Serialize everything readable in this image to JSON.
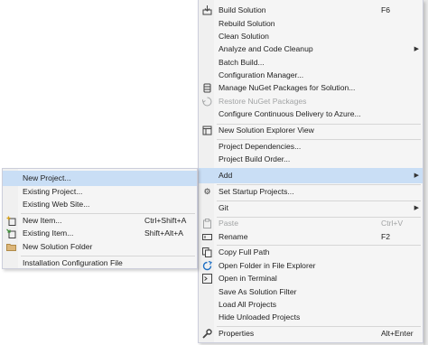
{
  "main_menu": {
    "items": [
      {
        "label": "Build Solution",
        "shortcut": "F6",
        "icon": "build-icon"
      },
      {
        "label": "Rebuild Solution"
      },
      {
        "label": "Clean Solution"
      },
      {
        "label": "Analyze and Code Cleanup",
        "submenu": true
      },
      {
        "label": "Batch Build..."
      },
      {
        "label": "Configuration Manager..."
      },
      {
        "label": "Manage NuGet Packages for Solution...",
        "icon": "nuget-icon"
      },
      {
        "label": "Restore NuGet Packages",
        "icon": "restore-icon",
        "disabled": true
      },
      {
        "label": "Configure Continuous Delivery to Azure..."
      },
      {
        "label": "New Solution Explorer View",
        "icon": "new-view-icon"
      },
      {
        "label": "Project Dependencies..."
      },
      {
        "label": "Project Build Order..."
      },
      {
        "label": "Add",
        "submenu": true,
        "highlighted": true
      },
      {
        "label": "Set Startup Projects...",
        "icon": "gear-icon"
      },
      {
        "label": "Git",
        "submenu": true
      },
      {
        "label": "Paste",
        "shortcut": "Ctrl+V",
        "icon": "paste-icon",
        "disabled": true
      },
      {
        "label": "Rename",
        "shortcut": "F2",
        "icon": "rename-icon"
      },
      {
        "label": "Copy Full Path",
        "icon": "copy-icon"
      },
      {
        "label": "Open Folder in File Explorer",
        "icon": "open-folder-icon"
      },
      {
        "label": "Open in Terminal",
        "icon": "terminal-icon"
      },
      {
        "label": "Save As Solution Filter"
      },
      {
        "label": "Load All Projects"
      },
      {
        "label": "Hide Unloaded Projects"
      },
      {
        "label": "Properties",
        "shortcut": "Alt+Enter",
        "icon": "wrench-icon"
      }
    ]
  },
  "add_submenu": {
    "items": [
      {
        "label": "New Project...",
        "highlighted": true
      },
      {
        "label": "Existing Project..."
      },
      {
        "label": "Existing Web Site..."
      },
      {
        "label": "New Item...",
        "shortcut": "Ctrl+Shift+A",
        "icon": "new-item-icon"
      },
      {
        "label": "Existing Item...",
        "shortcut": "Shift+Alt+A",
        "icon": "existing-item-icon"
      },
      {
        "label": "New Solution Folder",
        "icon": "folder-icon"
      },
      {
        "label": "Installation Configuration File"
      }
    ]
  },
  "colors": {
    "menu_background": "#f5f5f5",
    "highlight": "#c9def5",
    "disabled_text": "#a2a4a5"
  }
}
